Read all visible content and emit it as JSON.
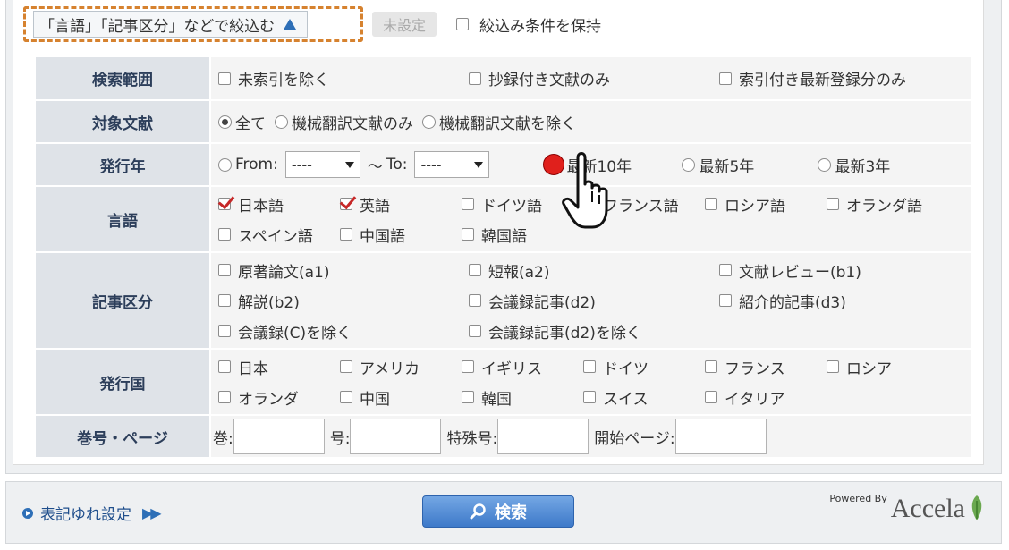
{
  "topbar": {
    "filter_toggle_label": "「言語」「記事区分」などで絞込む",
    "unset_button": "未設定",
    "keep_conditions_label": "絞込み条件を保持"
  },
  "rows": {
    "search_scope": {
      "label": "検索範囲",
      "options": [
        "未索引を除く",
        "抄録付き文献のみ",
        "索引付き最新登録分のみ"
      ]
    },
    "target_docs": {
      "label": "対象文献",
      "options": [
        "全て",
        "機械翻訳文献のみ",
        "機械翻訳文献を除く"
      ],
      "selected": "全て"
    },
    "pub_year": {
      "label": "発行年",
      "from_label": "From:",
      "from_value": "----",
      "tilde": "～",
      "to_label": "To:",
      "to_value": "----",
      "options": [
        "最新10年",
        "最新5年",
        "最新3年"
      ]
    },
    "language": {
      "label": "言語",
      "line1": [
        "日本語",
        "英語",
        "ドイツ語",
        "フランス語",
        "ロシア語",
        "オランダ語"
      ],
      "line2": [
        "スペイン語",
        "中国語",
        "韓国語"
      ],
      "checked": [
        "日本語",
        "英語"
      ]
    },
    "article_type": {
      "label": "記事区分",
      "line1": [
        "原著論文(a1)",
        "短報(a2)",
        "文献レビュー(b1)"
      ],
      "line2": [
        "解説(b2)",
        "会議録記事(d2)",
        "紹介的記事(d3)"
      ],
      "line3": [
        "会議録(C)を除く",
        "会議録記事(d2)を除く"
      ]
    },
    "country": {
      "label": "発行国",
      "line1": [
        "日本",
        "アメリカ",
        "イギリス",
        "ドイツ",
        "フランス",
        "ロシア"
      ],
      "line2": [
        "オランダ",
        "中国",
        "韓国",
        "スイス",
        "イタリア"
      ]
    },
    "volume": {
      "label": "巻号・ページ",
      "vol": "巻:",
      "no": "号:",
      "special": "特殊号:",
      "start_page": "開始ページ:"
    }
  },
  "footer": {
    "variant_link": "表記ゆれ設定",
    "search_button": "検索",
    "powered_by": "Powered By",
    "brand": "Accela"
  },
  "colors": {
    "accent_blue": "#2e6fb7",
    "dashed_orange": "#d6822f",
    "check_red": "#c62828",
    "radio_highlight": "#e0201c"
  }
}
